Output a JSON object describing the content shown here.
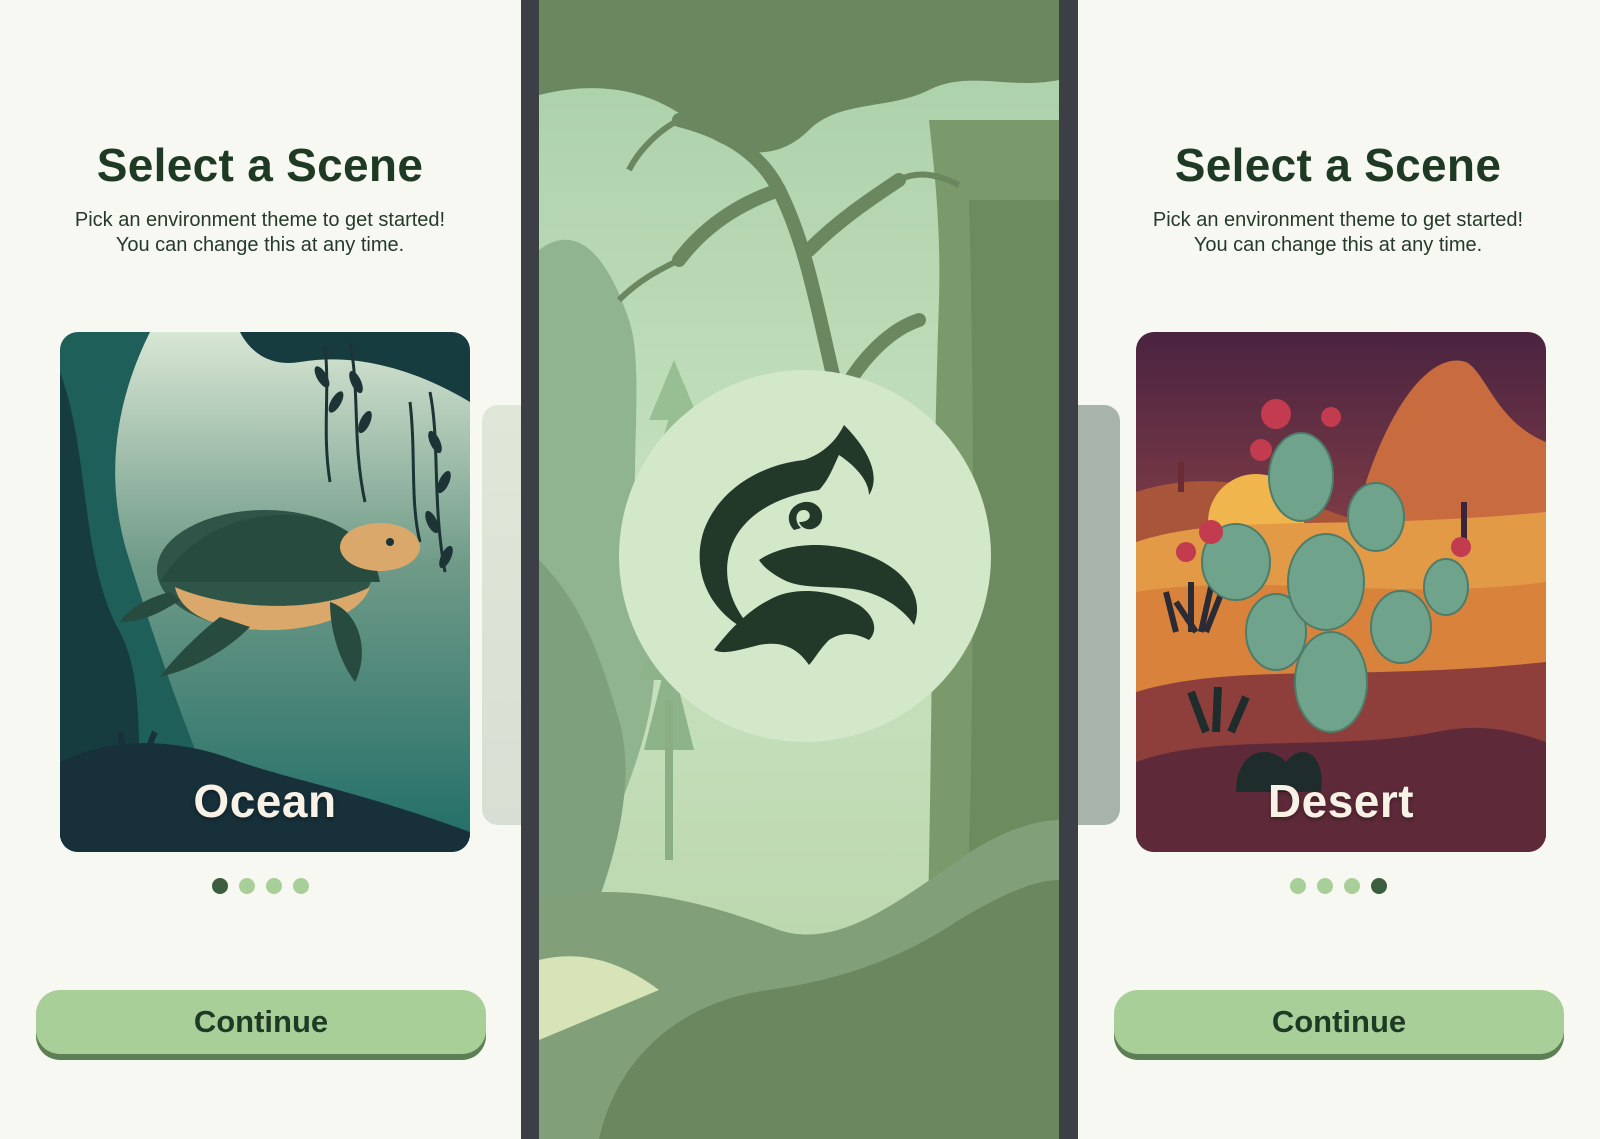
{
  "screens": {
    "left": {
      "title": "Select a Scene",
      "subtitle_line1": "Pick an environment theme to get started!",
      "subtitle_line2": "You can change this at any time.",
      "card_label": "Ocean",
      "pager": {
        "total": 4,
        "active_index": 0
      },
      "continue_label": "Continue"
    },
    "center": {
      "logo_icon": "animal-silhouettes-logo-icon",
      "background_theme": "misty forest"
    },
    "right": {
      "title": "Select a Scene",
      "subtitle_line1": "Pick an environment theme to get started!",
      "subtitle_line2": "You can change this at any time.",
      "card_label": "Desert",
      "pager": {
        "total": 4,
        "active_index": 3
      },
      "continue_label": "Continue"
    }
  },
  "colors": {
    "background": "#f7f8f2",
    "title_text": "#1f3a24",
    "button": "#a9cf98",
    "dot_active": "#3b5e3e",
    "dot_inactive": "#a9cf98"
  }
}
